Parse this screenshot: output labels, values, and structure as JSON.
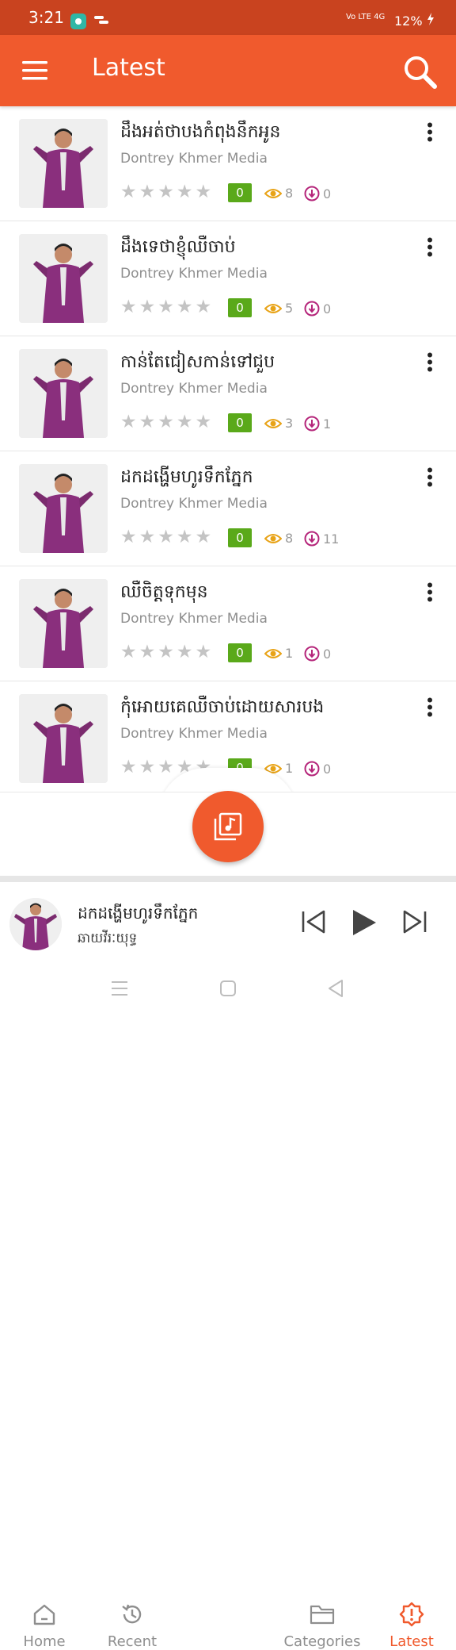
{
  "status_bar": {
    "time": "3:21",
    "network": "Vo LTE",
    "signal": "4G",
    "battery": "12%"
  },
  "app_bar": {
    "title": "Latest",
    "menu_icon": "hamburger-menu-icon",
    "search_icon": "search-icon"
  },
  "songs": [
    {
      "title": "ដឹងអត់ថាបងកំពុងនឹកអូន",
      "artist": "Dontrey Khmer Media",
      "rating": "0",
      "views": "8",
      "downloads": "0"
    },
    {
      "title": "ដឹងទេថាខ្ញុំឈឺចាប់",
      "artist": "Dontrey Khmer Media",
      "rating": "0",
      "views": "5",
      "downloads": "0"
    },
    {
      "title": "កាន់តែជៀសកាន់ទៅជួប",
      "artist": "Dontrey Khmer Media",
      "rating": "0",
      "views": "3",
      "downloads": "1"
    },
    {
      "title": "ដកដង្ហើមហូរទឹកភ្នែក",
      "artist": "Dontrey Khmer Media",
      "rating": "0",
      "views": "8",
      "downloads": "11"
    },
    {
      "title": "ឈឺចិត្តទុកមុន",
      "artist": "Dontrey Khmer Media",
      "rating": "0",
      "views": "1",
      "downloads": "0"
    },
    {
      "title": "កុំអោយគេឈឺចាប់ដោយសារបង",
      "artist": "Dontrey Khmer Media",
      "rating": "0",
      "views": "1",
      "downloads": "0"
    }
  ],
  "bottom_nav": {
    "items": [
      {
        "label": "Home",
        "icon": "home-icon"
      },
      {
        "label": "Recent",
        "icon": "history-icon"
      },
      {
        "label": "Categories",
        "icon": "folder-icon"
      },
      {
        "label": "Latest",
        "icon": "alert-badge-icon"
      }
    ],
    "active": "Latest",
    "center_icon": "music-library-icon"
  },
  "now_playing": {
    "title": "ដកដង្ហើមហូរទឹកភ្នែក",
    "artist": "ឆាយវីរៈយុទ្ធ"
  },
  "colors": {
    "primary": "#f05a2d",
    "status_bar": "#c9431f",
    "rating_badge": "#5aa91a",
    "views_icon": "#e8a317",
    "downloads_icon": "#b5257a"
  }
}
